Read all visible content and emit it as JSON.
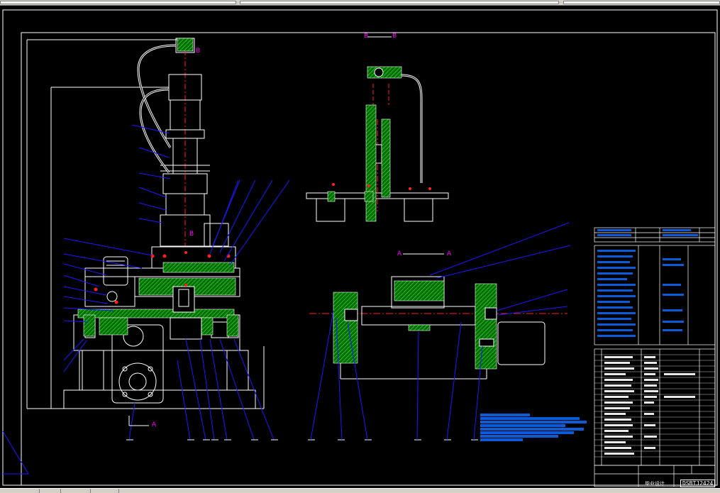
{
  "app": {
    "colors": {
      "background": "#000000",
      "line": "#ffffff",
      "leader": "#1a1aff",
      "hatch": "#00c000",
      "section_label": "#ff00ff",
      "centerline": "#ff2020",
      "notes": "#0e5bd8"
    }
  },
  "drawing": {
    "view_labels": {
      "section_bb_top_left": "B",
      "section_bb_top_right": "B",
      "section_aa_left": "A",
      "section_aa_right": "A",
      "cut_b_upper": "B",
      "cut_b_lower": "B",
      "cut_a_bottom": "A"
    },
    "title_block": {
      "caption": "毕业设计",
      "drawing_number": "DSBTJ2424"
    }
  }
}
